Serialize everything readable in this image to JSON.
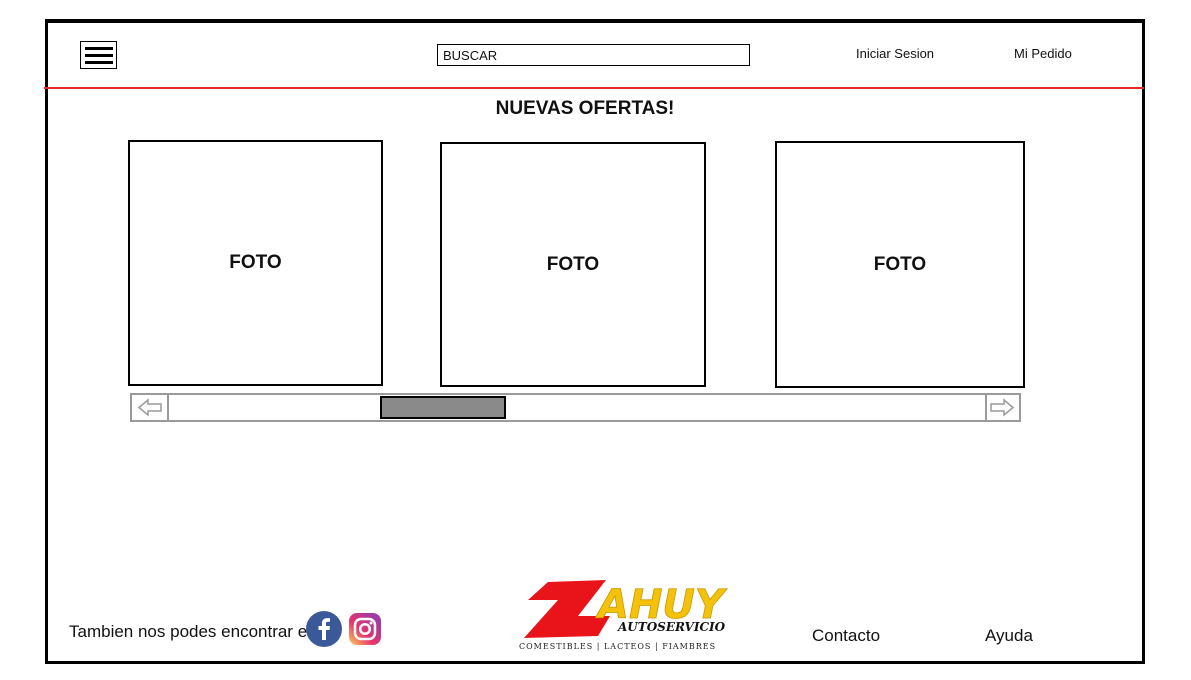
{
  "header": {
    "search_placeholder": "BUSCAR",
    "login_label": "Iniciar Sesion",
    "order_label": "Mi Pedido"
  },
  "offers": {
    "title": "NUEVAS OFERTAS!",
    "cards": [
      {
        "label": "FOTO"
      },
      {
        "label": "FOTO"
      },
      {
        "label": "FOTO"
      }
    ]
  },
  "footer": {
    "social_text": "Tambien nos podes encontrar en",
    "logo_text": "ZAHUY",
    "logo_tagline": "AUTOSERVICIO",
    "logo_sub": "COMESTIBLES | LACTEOS | FIAMBRES",
    "contact_label": "Contacto",
    "help_label": "Ayuda"
  },
  "icons": {
    "menu": "hamburger-menu-icon",
    "facebook": "facebook-icon",
    "instagram": "instagram-icon",
    "scroll_left": "arrow-left-icon",
    "scroll_right": "arrow-right-icon"
  },
  "colors": {
    "accent_red": "#e12b2b",
    "logo_red": "#e8141a",
    "logo_yellow": "#f5c20b",
    "facebook_blue": "#3b5998"
  }
}
